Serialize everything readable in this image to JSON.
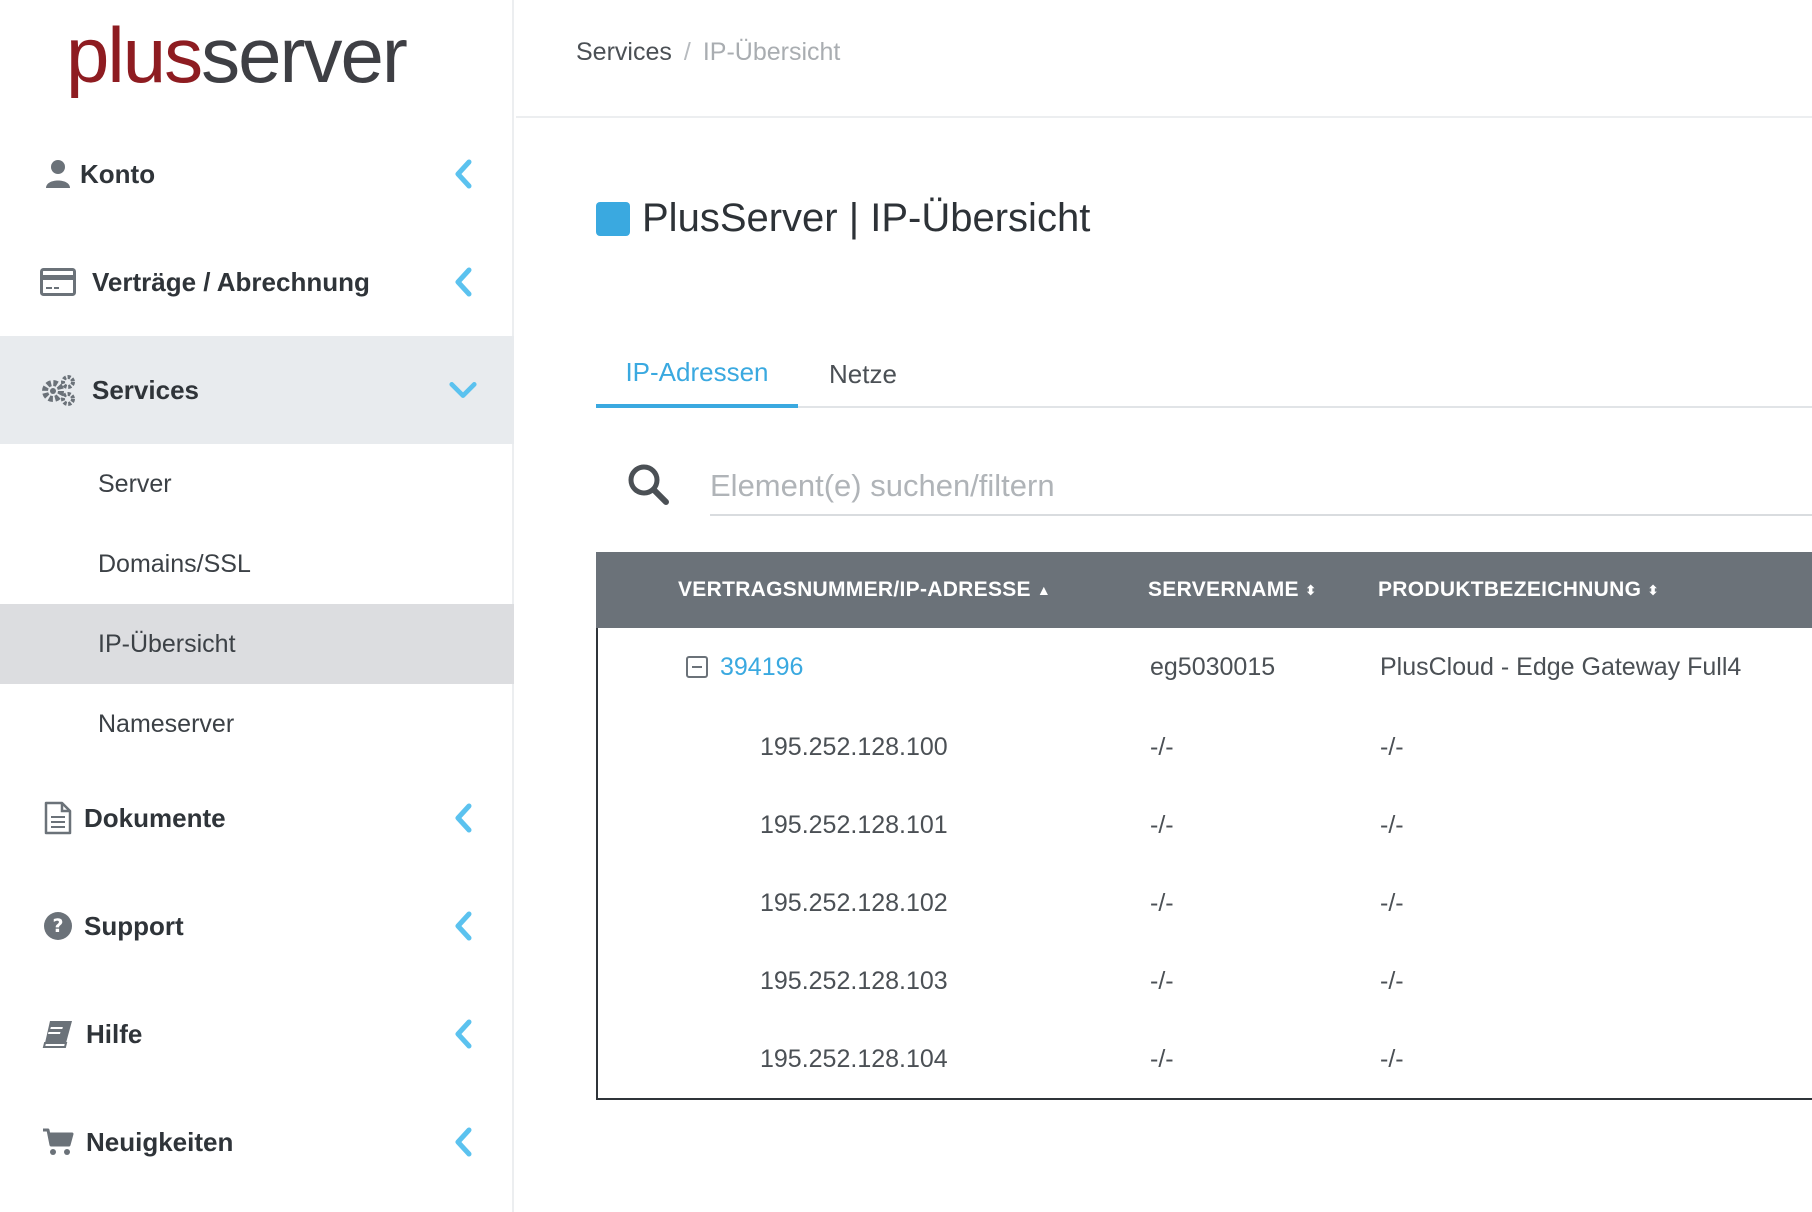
{
  "logo": {
    "part1": "plus",
    "part2": "server"
  },
  "sidebar": {
    "items": [
      {
        "label": "Konto",
        "icon": "user-icon"
      },
      {
        "label": "Verträge / Abrechnung",
        "icon": "credit-card-icon"
      },
      {
        "label": "Services",
        "icon": "gears-icon",
        "expanded": true
      },
      {
        "label": "Dokumente",
        "icon": "document-icon"
      },
      {
        "label": "Support",
        "icon": "question-circle-icon"
      },
      {
        "label": "Hilfe",
        "icon": "book-icon"
      },
      {
        "label": "Neuigkeiten",
        "icon": "cart-icon"
      }
    ],
    "sub_items": [
      {
        "label": "Server"
      },
      {
        "label": "Domains/SSL"
      },
      {
        "label": "IP-Übersicht",
        "active": true
      },
      {
        "label": "Nameserver"
      }
    ]
  },
  "breadcrumb": {
    "parent": "Services",
    "separator": "/",
    "current": "IP-Übersicht"
  },
  "page": {
    "title": "PlusServer | IP-Übersicht"
  },
  "tabs": [
    {
      "label": "IP-Adressen",
      "active": true
    },
    {
      "label": "Netze",
      "active": false
    }
  ],
  "search": {
    "placeholder": "Element(e) suchen/filtern",
    "value": ""
  },
  "table": {
    "columns": [
      {
        "label": "VERTRAGSNUMMER/IP-ADRESSE",
        "sort": "asc"
      },
      {
        "label": "SERVERNAME",
        "sort": "both"
      },
      {
        "label": "PRODUKTBEZEICHNUNG",
        "sort": "both"
      }
    ],
    "group": {
      "contract": "394196",
      "servername": "eg5030015",
      "product": "PlusCloud - Edge Gateway Full4"
    },
    "rows": [
      {
        "ip": "195.252.128.100",
        "servername": "-/-",
        "product": "-/-"
      },
      {
        "ip": "195.252.128.101",
        "servername": "-/-",
        "product": "-/-"
      },
      {
        "ip": "195.252.128.102",
        "servername": "-/-",
        "product": "-/-"
      },
      {
        "ip": "195.252.128.103",
        "servername": "-/-",
        "product": "-/-"
      },
      {
        "ip": "195.252.128.104",
        "servername": "-/-",
        "product": "-/-"
      }
    ]
  },
  "colors": {
    "accent": "#3aa9e0",
    "brand_red": "#8e1c21",
    "header_bg": "#6b7279",
    "active_nav_bg": "#e8ebee"
  }
}
